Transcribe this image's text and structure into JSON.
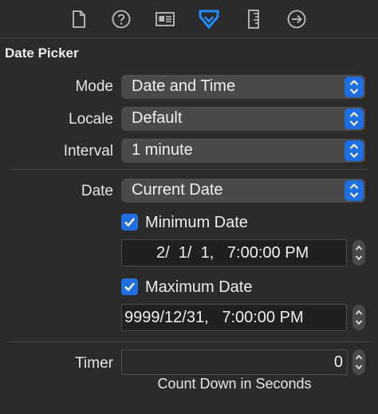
{
  "toolbar": {
    "icons": [
      "file-icon",
      "help-icon",
      "identity-icon",
      "attributes-icon",
      "ruler-icon",
      "connections-icon"
    ],
    "active_color": "#1f8fff",
    "icon_color": "#bdbdbd"
  },
  "section_title": "Date Picker",
  "mode": {
    "label": "Mode",
    "value": "Date and Time"
  },
  "locale": {
    "label": "Locale",
    "value": "Default"
  },
  "interval": {
    "label": "Interval",
    "value": "1 minute"
  },
  "date": {
    "label": "Date",
    "value": "Current Date"
  },
  "minimum_date": {
    "label": "Minimum Date",
    "checked": true,
    "value": "2/  1/  1,   7:00:00 PM"
  },
  "maximum_date": {
    "label": "Maximum Date",
    "checked": true,
    "value": "9999/12/31,   7:00:00 PM"
  },
  "timer": {
    "label": "Timer",
    "value": "0",
    "caption": "Count Down in Seconds"
  },
  "colors": {
    "accent": "#1f6fe0",
    "background": "#2b2b2c",
    "control": "#4a4a4c"
  }
}
